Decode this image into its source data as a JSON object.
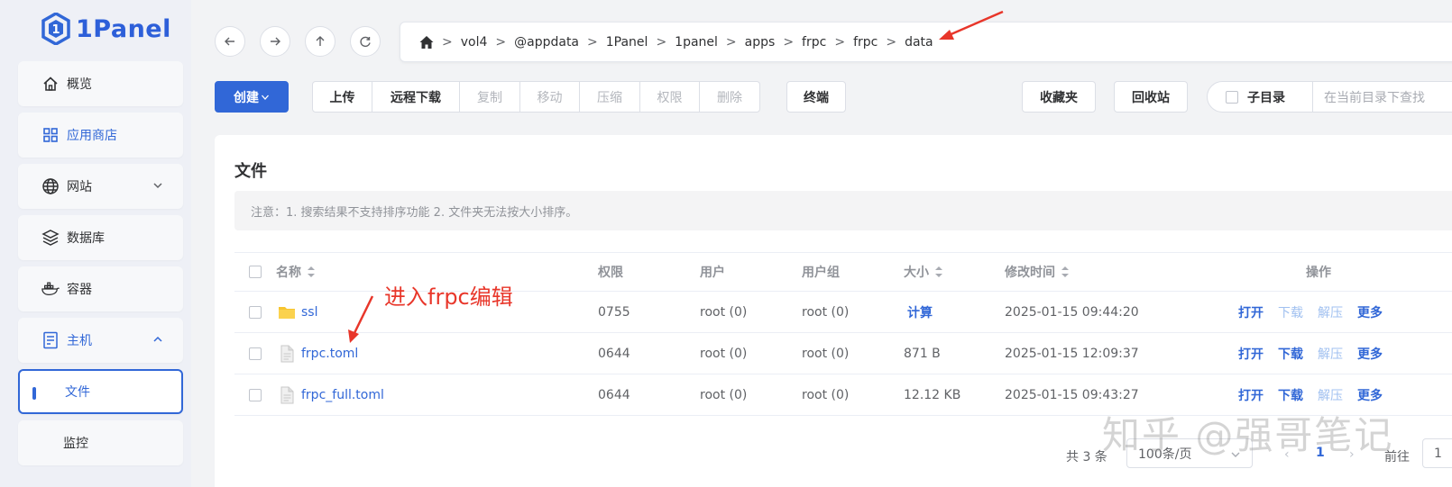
{
  "brand": {
    "name": "1Panel",
    "color": "#3167d7"
  },
  "sidebar": {
    "items": [
      {
        "label": "概览",
        "icon": "home-icon"
      },
      {
        "label": "应用商店",
        "icon": "apps-grid-icon"
      },
      {
        "label": "网站",
        "icon": "globe-icon"
      },
      {
        "label": "数据库",
        "icon": "database-layers-icon"
      },
      {
        "label": "容器",
        "icon": "docker-icon"
      },
      {
        "label": "主机",
        "icon": "host-icon"
      },
      {
        "label": "文件"
      },
      {
        "label": "监控"
      }
    ]
  },
  "path": {
    "segments": [
      "vol4",
      "@appdata",
      "1Panel",
      "1panel",
      "apps",
      "frpc",
      "frpc",
      "data"
    ]
  },
  "toolbar": {
    "create": "创建",
    "group": [
      "上传",
      "远程下载",
      "复制",
      "移动",
      "压缩",
      "权限",
      "删除"
    ],
    "terminal": "终端",
    "favorites": "收藏夹",
    "recycle": "回收站",
    "subdir": "子目录",
    "search_placeholder": "在当前目录下查找"
  },
  "panel": {
    "title": "文件",
    "notice": "注意：1. 搜索结果不支持排序功能 2. 文件夹无法按大小排序。"
  },
  "table": {
    "headers": {
      "name": "名称",
      "perm": "权限",
      "user": "用户",
      "group": "用户组",
      "size": "大小",
      "mtime": "修改时间",
      "ops": "操作"
    },
    "rows": [
      {
        "name": "ssl",
        "type": "folder",
        "perm": "0755",
        "user": "root (0)",
        "group": "root (0)",
        "size": "计算",
        "mtime": "2025-01-15 09:44:20"
      },
      {
        "name": "frpc.toml",
        "type": "file",
        "perm": "0644",
        "user": "root (0)",
        "group": "root (0)",
        "size": "871 B",
        "mtime": "2025-01-15 12:09:37"
      },
      {
        "name": "frpc_full.toml",
        "type": "file",
        "perm": "0644",
        "user": "root (0)",
        "group": "root (0)",
        "size": "12.12 KB",
        "mtime": "2025-01-15 09:43:27"
      }
    ],
    "ops": {
      "open": "打开",
      "download": "下载",
      "extract": "解压",
      "more": "更多"
    }
  },
  "pager": {
    "total": "共 3 条",
    "page_size": "100条/页",
    "current": "1",
    "goto": "前往",
    "goto_value": "1"
  },
  "annotation": {
    "text": "进入frpc编辑",
    "color": "#e8362a"
  },
  "watermark": "知乎 @强哥笔记"
}
